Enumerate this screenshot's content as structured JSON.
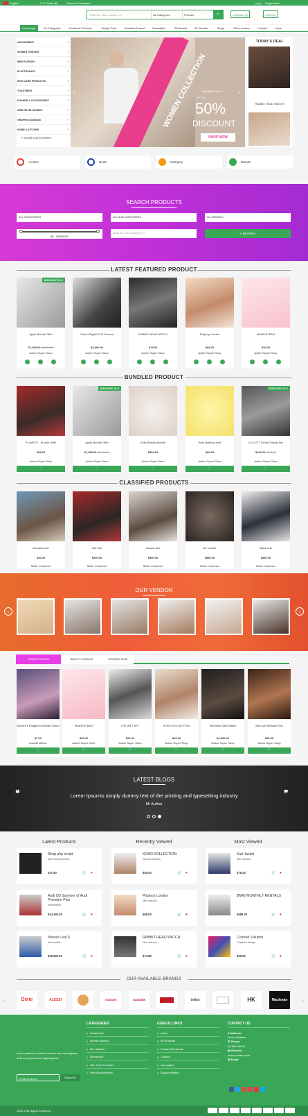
{
  "topbar": {
    "language": "English",
    "currency": "U.S. Dollar ($)",
    "packages": "Premium Packages",
    "login": "Login",
    "register": "Registration"
  },
  "search": {
    "placeholder": "What Are You Looking For?",
    "category": "All Categories",
    "type": "Product"
  },
  "header": {
    "compare": "Compare (0)",
    "cart": "0 item(s)"
  },
  "nav": [
    "Homepage",
    "All Categories",
    "Featured Products",
    "Todays Deal",
    "Bundled Product",
    "Classifieds",
    "All Brands",
    "All Vendors",
    "Blogs",
    "Store Locator",
    "Contact",
    "More"
  ],
  "sidemenu": {
    "items": [
      "AUTOMOBILE",
      "WOMEN FASHION",
      "MEN FASHION",
      "ELECTRONICS",
      "SKIN CARE PRODUCTS",
      "TOILETRIES",
      "PHONES & ACCESSORIES",
      "WEB DEVELOPMENT",
      "GRAPHICS DESIGN",
      "HOME & KITCHEN"
    ],
    "more": "MORE CATEGORIES"
  },
  "hero": {
    "banner": "WOMEN COLLECTION",
    "sale": "SUMMER SALE",
    "upto": "UP TO",
    "percent": "50%",
    "discount": "DISCOUNT",
    "cta": "SHOP NOW"
  },
  "today_deal": {
    "title": "TODAY'S DEAL",
    "item": "RABBIT HEAD WATCH"
  },
  "features": [
    "Auction",
    "Deals",
    "Category",
    "Brands"
  ],
  "search_products": {
    "title": "SEARCH PRODUCTS",
    "categories": "ALL CATEGORIES",
    "sub": "ALL SUB CATEGORIES",
    "brands": "ALL BRANDS",
    "range": "$0 - $4880000",
    "placeholder": "What Are You Looking For?",
    "button": "SEARCH"
  },
  "featured": {
    "title": "LATEST FEATURED PRODUCT",
    "items": [
      {
        "name": "Apple Bundle Offer",
        "price": "$7,390.00",
        "old": "$8,000.00",
        "shop": "Active Super Shop",
        "badge": "DISCOUNT 16 %"
      },
      {
        "name": "Canon Digital SLR Camera",
        "price": "$3,500.00",
        "old": "",
        "shop": "Active Super Shop",
        "badge": ""
      },
      {
        "name": "RABBIT HEAD WATCH",
        "price": "$74.80",
        "old": "",
        "shop": "Active Super Shop",
        "badge": ""
      },
      {
        "name": "Playboy London",
        "price": "$68.00",
        "old": "",
        "shop": "Active Super Shop",
        "badge": ""
      },
      {
        "name": "MAKEUP BAG",
        "price": "$30.00",
        "old": "",
        "shop": "Active Super Shop",
        "badge": ""
      }
    ]
  },
  "bundled": {
    "title": "BUNDLED PRODUCT",
    "items": [
      {
        "name": "PLAYBOY - Bundle Offer",
        "price": "$98.00",
        "old": "",
        "shop": "Active Super Shop",
        "badge": ""
      },
      {
        "name": "Apple Bundle Offer",
        "price": "$7,390.00",
        "old": "$8,000.00",
        "shop": "Active Super Shop",
        "badge": "DISCOUNT 16 %"
      },
      {
        "name": "Kylie Beauty Bundle",
        "price": "$300.00",
        "old": "",
        "shop": "Active Super Shop",
        "badge": ""
      },
      {
        "name": "Best Makeup deal",
        "price": "$80.00",
        "old": "",
        "shop": "Active Super Shop",
        "badge": ""
      },
      {
        "name": "ELLIOTT Formal Dining Set",
        "price": "$449.10",
        "old": "$499.00",
        "shop": "Active Super Shop",
        "badge": "DISCOUNT 10 %"
      }
    ]
  },
  "classified": {
    "title": "CLASSIFIED PRODUCTS",
    "items": [
      {
        "name": "Bocsted heel",
        "price": "$40.00",
        "shop": "Seller Customer"
      },
      {
        "name": "Set Suit",
        "price": "$250.00",
        "shop": "Seller Customer"
      },
      {
        "name": "Casual Suit",
        "price": "$350.00",
        "shop": "Seller Customer"
      },
      {
        "name": "All Travels",
        "price": "$850.00",
        "shop": "Seller Customer"
      },
      {
        "name": "Black suit",
        "price": "$460.00",
        "shop": "Seller Customer"
      }
    ]
  },
  "vendor": {
    "title": "OUR VENDOR"
  },
  "tabs": [
    "WOMEN FASHION",
    "BEAUTY & HEALTH",
    "WOMEN'S SHOE"
  ],
  "tab_items": [
    {
      "name": "Women's Elegant Envelope Clutch",
      "price": "$7.00",
      "shop": "Lavinia Mckee"
    },
    {
      "name": "MAKEUP BAG",
      "price": "$30.00",
      "shop": "Active Super Shop"
    },
    {
      "name": "THE WET SET",
      "price": "$62.00",
      "shop": "Active Super Shop"
    },
    {
      "name": "KOKO KOLLECTION",
      "price": "$40.00",
      "shop": "Active Super Shop"
    },
    {
      "name": "Stainless Steel Watch",
      "price": "$4,530.00",
      "shop": "Active Super Shop"
    },
    {
      "name": "BinLove Necklace Set",
      "price": "$18.95",
      "shop": "Active Super Shop"
    }
  ],
  "blogs": {
    "title": "LATEST BLOGS",
    "quote": "Lorem Ipsumis simply dummy text of the printing and typesetting industry",
    "author": "Mr Author"
  },
  "lists": [
    {
      "title": "Latest Products",
      "items": [
        {
          "name": "Shop php script",
          "cat": "Web Development",
          "price": "$37.50"
        },
        {
          "name": "Audi Q5 Summer of Audi Premium Plus",
          "cat": "Automobile",
          "price": "$44,190.00"
        },
        {
          "name": "Nissan Leaf S",
          "cat": "Automobile",
          "price": "$15,550.00"
        }
      ]
    },
    {
      "title": "Recently Viewed",
      "items": [
        {
          "name": "KOKO KOLLECTION",
          "cat": "Women fashion",
          "price": "$40.00"
        },
        {
          "name": "Playboy London",
          "cat": "Men fashion",
          "price": "$68.00"
        },
        {
          "name": "RABBIT HEAD WATCH",
          "cat": "Men fashion",
          "price": "$74.80"
        }
      ]
    },
    {
      "title": "Most Viewed",
      "items": [
        {
          "name": "Suit Jacket",
          "cat": "Men fashion",
          "price": "$79.20"
        },
        {
          "name": "BMW MONTHLY RENTALS",
          "cat": "",
          "price": "$989.29"
        },
        {
          "name": "Colored Solution",
          "cat": "Graphics design",
          "price": "$25.00"
        }
      ]
    }
  ],
  "brands": {
    "title": "OUR AVAILABLE BRANDS",
    "items": [
      "Dixie",
      "ALESSI",
      "",
      "VOSSEN",
      "SanDisk",
      "",
      "belkin",
      "",
      "HK",
      "Mackman"
    ]
  },
  "footer": {
    "about": "such a platform to build a border less marketplace both for physical and digital goods.",
    "email_placeholder": "Email Address",
    "subscribe": "Subscribe",
    "categories_title": "CATEGORIES",
    "categories": [
      "Automobile",
      "Women fashion",
      "Men fashion",
      "Electronics",
      "Skin Care Products",
      "Web Development"
    ],
    "links_title": "USEFUL LINKS",
    "links": [
      "Home",
      "All Products",
      "Featured Products",
      "Contact",
      "new page1",
      "Documentation"
    ],
    "contact_title": "CONTACT US",
    "address_label": "Address:",
    "address": "Demo Address",
    "phone_label": "Phone:",
    "phone": "00-000-00000",
    "website_label": "Website:",
    "website": "www.yoursite.com",
    "email_label": "Email:",
    "copyright": "2018 © All Rights Reserved"
  },
  "colors": {
    "accent": "#3aa757",
    "purple": "#c030d8",
    "orange": "#ec6a35",
    "pink": "#e91e63"
  }
}
